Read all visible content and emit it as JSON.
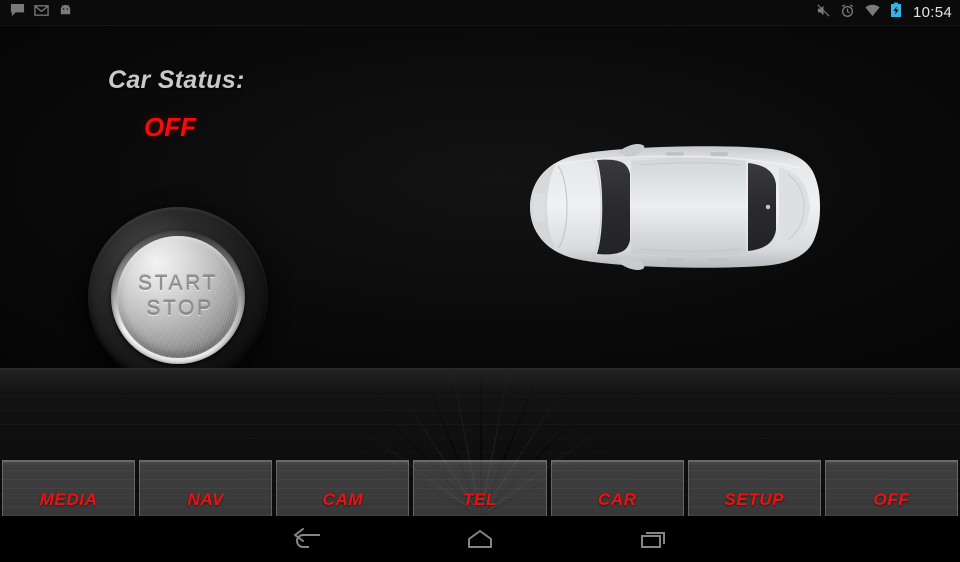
{
  "status_bar": {
    "left_icons": [
      {
        "name": "message-icon",
        "label": "Messages"
      },
      {
        "name": "email-icon",
        "label": "Email"
      },
      {
        "name": "android-icon",
        "label": "Android system"
      }
    ],
    "right_icons": [
      {
        "name": "mute-icon",
        "label": "Sound off"
      },
      {
        "name": "alarm-icon",
        "label": "Alarm set"
      },
      {
        "name": "wifi-icon",
        "label": "Wi-Fi"
      },
      {
        "name": "battery-charging-icon",
        "label": "Battery charging"
      }
    ],
    "clock": "10:54",
    "clock_color": "#dfe6ea",
    "battery_color": "#33b5e5"
  },
  "app": {
    "status": {
      "label": "Car Status:",
      "value": "OFF",
      "label_color": "#c9c9c9",
      "value_color": "#f00d0d"
    },
    "start_stop_button": {
      "line1": "START",
      "line2": "STOP",
      "text_color": "#8e8e8e"
    },
    "car_graphic": {
      "name": "car-top-view",
      "body_color": "#dcdee0",
      "glass_color": "#2e2e30"
    },
    "menu_buttons": [
      {
        "name": "menu-button-media",
        "label": "MEDIA"
      },
      {
        "name": "menu-button-nav",
        "label": "NAV"
      },
      {
        "name": "menu-button-cam",
        "label": "CAM"
      },
      {
        "name": "menu-button-tel",
        "label": "TEL"
      },
      {
        "name": "menu-button-car",
        "label": "CAR"
      },
      {
        "name": "menu-button-setup",
        "label": "SETUP"
      },
      {
        "name": "menu-button-off",
        "label": "OFF"
      }
    ],
    "menu_label_color": "#ee1111"
  },
  "nav_bar": {
    "buttons": [
      {
        "name": "back-icon",
        "label": "Back"
      },
      {
        "name": "home-icon",
        "label": "Home"
      },
      {
        "name": "recent-apps-icon",
        "label": "Recent apps"
      }
    ]
  }
}
